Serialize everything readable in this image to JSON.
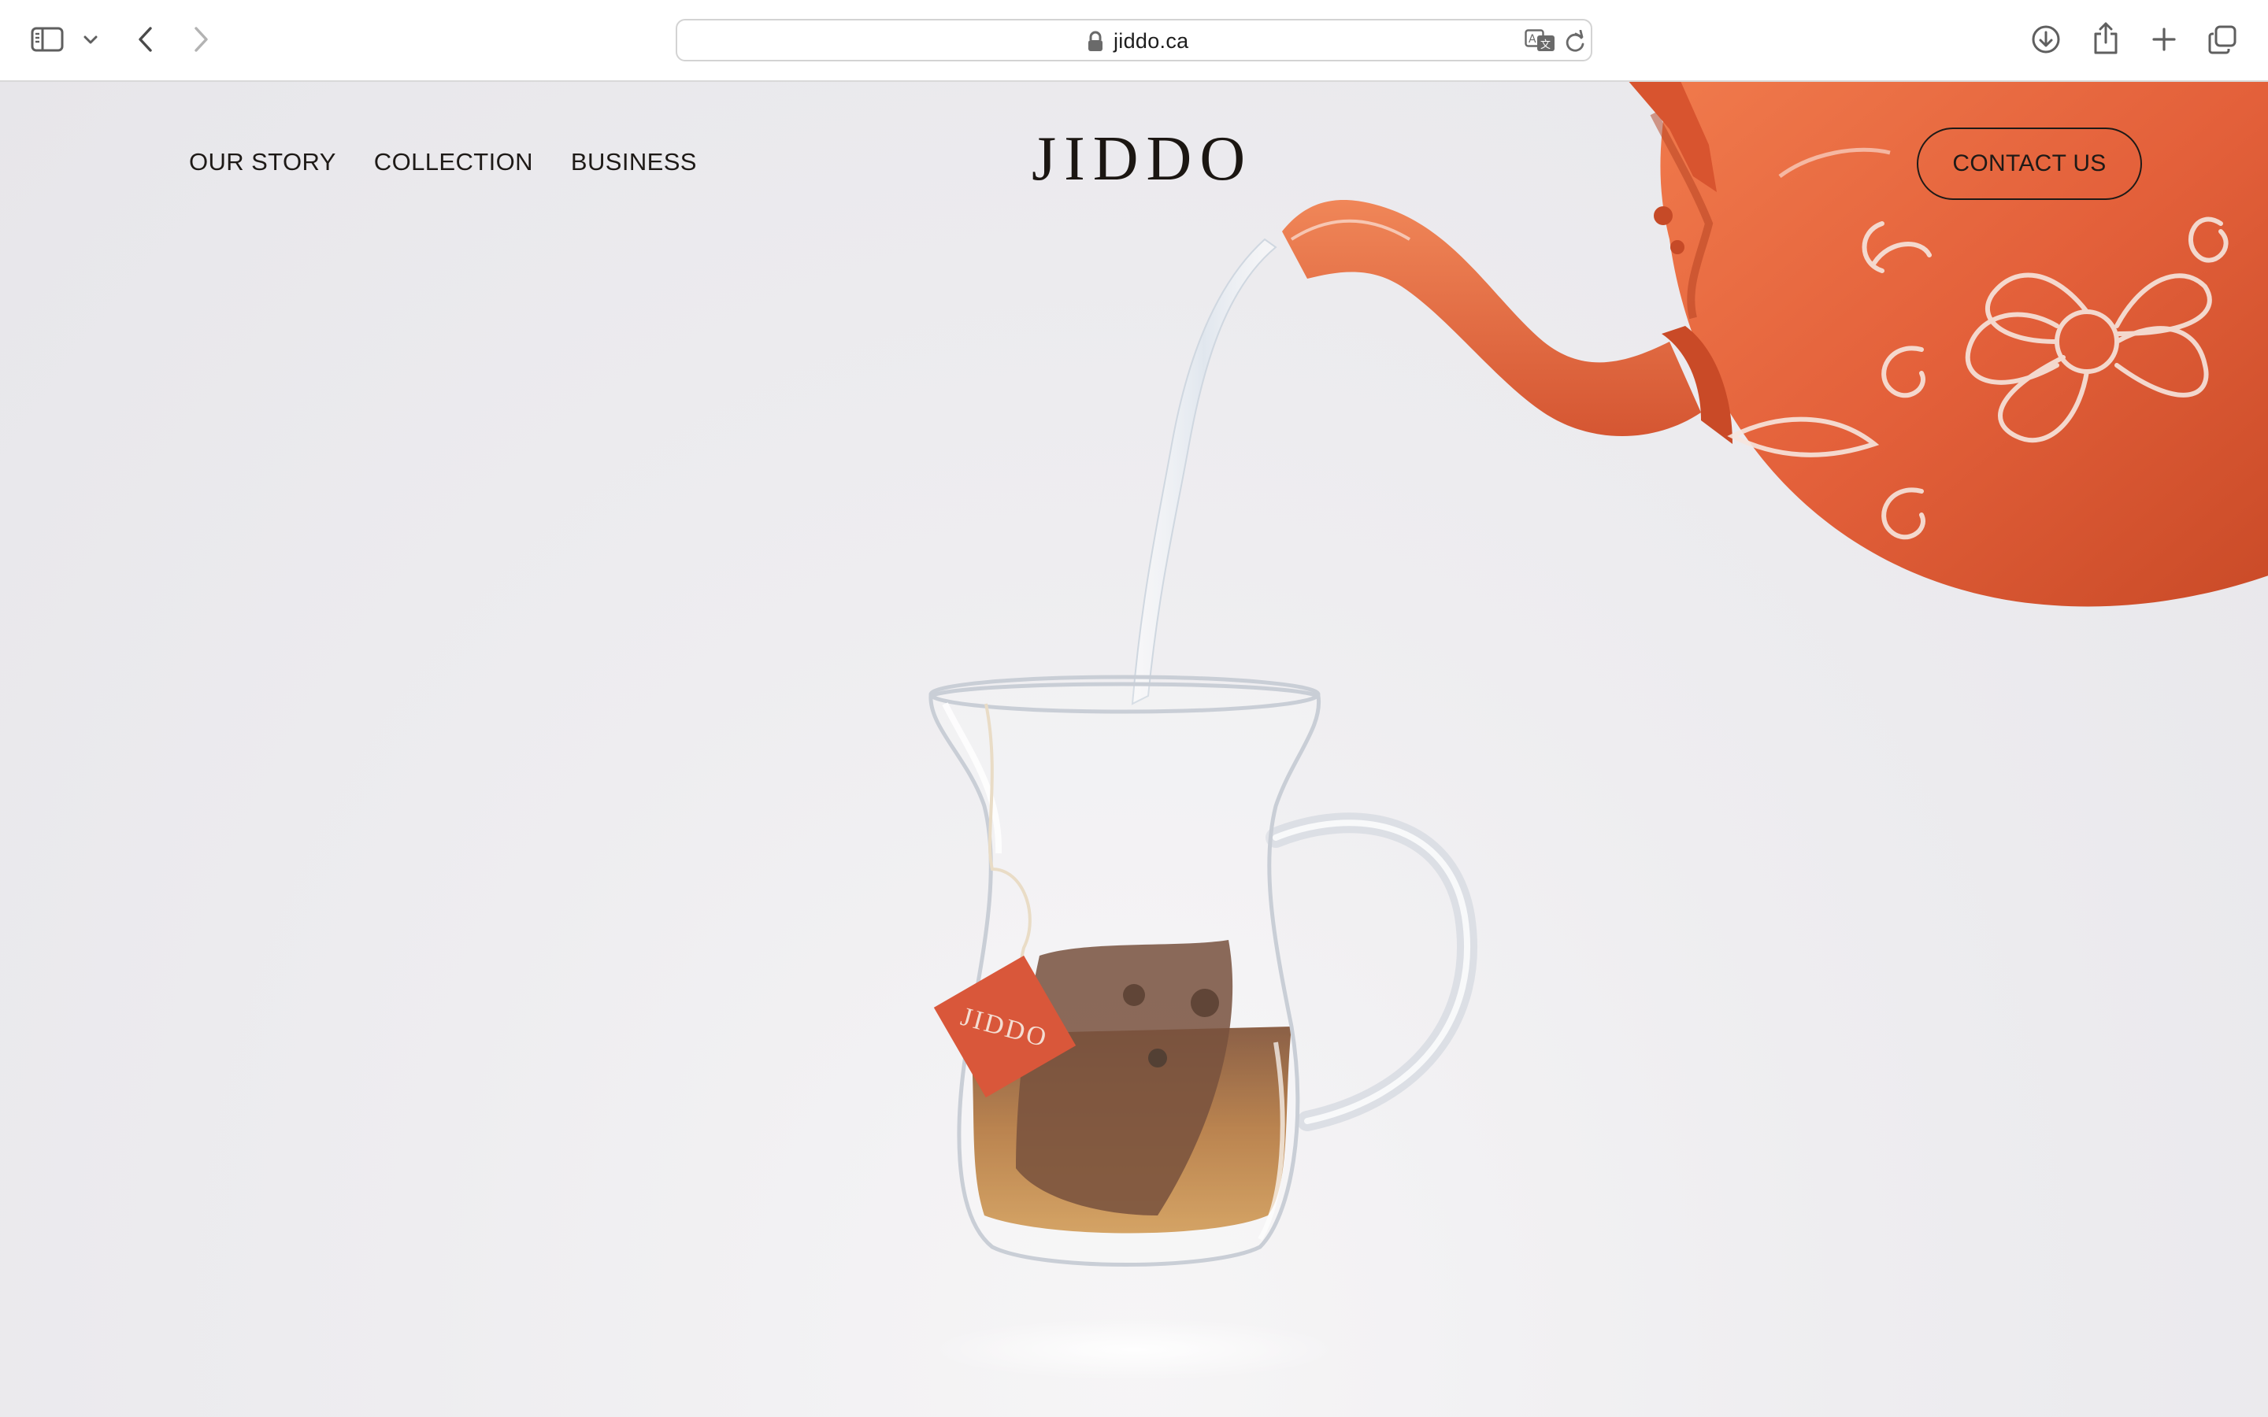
{
  "browser": {
    "url": "jiddo.ca",
    "icons": {
      "sidebar": "sidebar-icon",
      "sidebar_menu": "chevron-down-icon",
      "back": "back-arrow-icon",
      "forward": "forward-arrow-icon",
      "lock": "lock-icon",
      "translate": "translate-icon",
      "reload": "reload-icon",
      "download": "download-icon",
      "share": "share-icon",
      "new_tab": "plus-icon",
      "tabs": "tab-overview-icon"
    }
  },
  "site": {
    "nav": [
      {
        "label": "OUR STORY"
      },
      {
        "label": "COLLECTION"
      },
      {
        "label": "BUSINESS"
      }
    ],
    "logo": "JIDDO",
    "contact_label": "CONTACT US",
    "tea_tag_text": "JIDDO"
  },
  "colors": {
    "teapot": "#e5643a",
    "tea_tag": "#d9573a",
    "tea_liquid": "#a8621f",
    "text": "#1e1a17"
  }
}
